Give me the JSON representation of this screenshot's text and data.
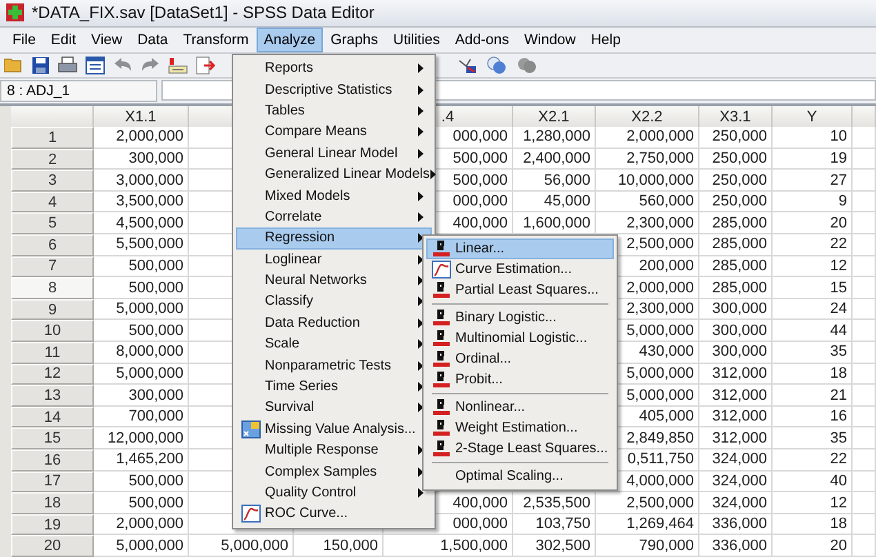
{
  "window": {
    "title": "*DATA_FIX.sav [DataSet1] - SPSS Data Editor"
  },
  "menu_bar": [
    {
      "label": "File",
      "selected": false
    },
    {
      "label": "Edit",
      "selected": false
    },
    {
      "label": "View",
      "selected": false
    },
    {
      "label": "Data",
      "selected": false
    },
    {
      "label": "Transform",
      "selected": false
    },
    {
      "label": "Analyze",
      "selected": true
    },
    {
      "label": "Graphs",
      "selected": false
    },
    {
      "label": "Utilities",
      "selected": false
    },
    {
      "label": "Add-ons",
      "selected": false
    },
    {
      "label": "Window",
      "selected": false
    },
    {
      "label": "Help",
      "selected": false
    }
  ],
  "cell_editor": {
    "reference": "8 : ADJ_1"
  },
  "table": {
    "columns": [
      "X1.1",
      null,
      null,
      ".4",
      "X2.1",
      "X2.2",
      "X3.1",
      "Y"
    ],
    "rows": [
      {
        "number": "1",
        "selected": false,
        "cells": [
          "2,000,000",
          null,
          null,
          "000,000",
          "1,280,000",
          "2,000,000",
          "250,000",
          "10"
        ]
      },
      {
        "number": "2",
        "selected": false,
        "cells": [
          "300,000",
          null,
          null,
          "500,000",
          "2,400,000",
          "2,750,000",
          "250,000",
          "19"
        ]
      },
      {
        "number": "3",
        "selected": false,
        "cells": [
          "3,000,000",
          null,
          null,
          "500,000",
          "56,000",
          "10,000,000",
          "250,000",
          "27"
        ]
      },
      {
        "number": "4",
        "selected": false,
        "cells": [
          "3,500,000",
          null,
          null,
          "000,000",
          "45,000",
          "560,000",
          "250,000",
          "9"
        ]
      },
      {
        "number": "5",
        "selected": false,
        "cells": [
          "4,500,000",
          null,
          null,
          "400,000",
          "1,600,000",
          "2,300,000",
          "285,000",
          "20"
        ]
      },
      {
        "number": "6",
        "selected": false,
        "cells": [
          "5,500,000",
          null,
          null,
          null,
          null,
          "2,500,000",
          "285,000",
          "22"
        ]
      },
      {
        "number": "7",
        "selected": false,
        "cells": [
          "500,000",
          null,
          null,
          null,
          null,
          "200,000",
          "285,000",
          "12"
        ]
      },
      {
        "number": "8",
        "selected": true,
        "cells": [
          "500,000",
          null,
          null,
          null,
          null,
          "2,000,000",
          "285,000",
          "15"
        ]
      },
      {
        "number": "9",
        "selected": false,
        "cells": [
          "5,000,000",
          null,
          null,
          null,
          null,
          "2,300,000",
          "300,000",
          "24"
        ]
      },
      {
        "number": "10",
        "selected": false,
        "cells": [
          "500,000",
          null,
          null,
          null,
          null,
          "5,000,000",
          "300,000",
          "44"
        ]
      },
      {
        "number": "11",
        "selected": false,
        "cells": [
          "8,000,000",
          null,
          null,
          null,
          null,
          "430,000",
          "300,000",
          "35"
        ]
      },
      {
        "number": "12",
        "selected": false,
        "cells": [
          "5,000,000",
          null,
          null,
          null,
          null,
          "5,000,000",
          "312,000",
          "18"
        ]
      },
      {
        "number": "13",
        "selected": false,
        "cells": [
          "300,000",
          null,
          null,
          null,
          null,
          "5,000,000",
          "312,000",
          "21"
        ]
      },
      {
        "number": "14",
        "selected": false,
        "cells": [
          "700,000",
          null,
          null,
          null,
          null,
          "405,000",
          "312,000",
          "16"
        ]
      },
      {
        "number": "15",
        "selected": false,
        "cells": [
          "12,000,000",
          null,
          null,
          null,
          null,
          "2,849,850",
          "312,000",
          "35"
        ]
      },
      {
        "number": "16",
        "selected": false,
        "cells": [
          "1,465,200",
          null,
          null,
          null,
          null,
          "0,511,750",
          "324,000",
          "22"
        ]
      },
      {
        "number": "17",
        "selected": false,
        "cells": [
          "500,000",
          null,
          null,
          null,
          null,
          "4,000,000",
          "324,000",
          "40"
        ]
      },
      {
        "number": "18",
        "selected": false,
        "cells": [
          "500,000",
          null,
          null,
          "400,000",
          "2,535,500",
          "2,500,000",
          "324,000",
          "12"
        ]
      },
      {
        "number": "19",
        "selected": false,
        "cells": [
          "2,000,000",
          null,
          null,
          "000,000",
          "103,750",
          "1,269,464",
          "336,000",
          "18"
        ]
      },
      {
        "number": "20",
        "selected": false,
        "cells": [
          "5,000,000",
          "5,000,000",
          "150,000",
          "1,500,000",
          "302,500",
          "790,000",
          "336,000",
          "20"
        ]
      }
    ]
  },
  "analyze_menu": {
    "items": [
      {
        "label": "Reports",
        "kind": "submenu",
        "selected": false
      },
      {
        "label": "Descriptive Statistics",
        "kind": "submenu",
        "selected": false
      },
      {
        "label": "Tables",
        "kind": "submenu",
        "selected": false
      },
      {
        "label": "Compare Means",
        "kind": "submenu",
        "selected": false
      },
      {
        "label": "General Linear Model",
        "kind": "submenu",
        "selected": false
      },
      {
        "label": "Generalized Linear Models",
        "kind": "submenu",
        "selected": false
      },
      {
        "label": "Mixed Models",
        "kind": "submenu",
        "selected": false
      },
      {
        "label": "Correlate",
        "kind": "submenu",
        "selected": false
      },
      {
        "label": "Regression",
        "kind": "submenu",
        "selected": true
      },
      {
        "label": "Loglinear",
        "kind": "submenu",
        "selected": false
      },
      {
        "label": "Neural Networks",
        "kind": "submenu",
        "selected": false
      },
      {
        "label": "Classify",
        "kind": "submenu",
        "selected": false
      },
      {
        "label": "Data Reduction",
        "kind": "submenu",
        "selected": false
      },
      {
        "label": "Scale",
        "kind": "submenu",
        "selected": false
      },
      {
        "label": "Nonparametric Tests",
        "kind": "submenu",
        "selected": false
      },
      {
        "label": "Time Series",
        "kind": "submenu",
        "selected": false
      },
      {
        "label": "Survival",
        "kind": "submenu",
        "selected": false
      },
      {
        "label": "Missing Value Analysis...",
        "kind": "grid",
        "selected": false
      },
      {
        "label": "Multiple Response",
        "kind": "submenu",
        "selected": false
      },
      {
        "label": "Complex Samples",
        "kind": "submenu",
        "selected": false
      },
      {
        "label": "Quality Control",
        "kind": "submenu",
        "selected": false
      },
      {
        "label": "ROC Curve...",
        "kind": "curve",
        "selected": false
      }
    ]
  },
  "regression_menu": {
    "items": [
      {
        "label": "Linear...",
        "kind": "regression",
        "selected": true
      },
      {
        "label": "Curve Estimation...",
        "kind": "curve",
        "selected": false
      },
      {
        "label": "Partial Least Squares...",
        "kind": "regression",
        "selected": false
      },
      {
        "kind": "separator"
      },
      {
        "label": "Binary Logistic...",
        "kind": "regression",
        "selected": false
      },
      {
        "label": "Multinomial Logistic...",
        "kind": "regression",
        "selected": false
      },
      {
        "label": "Ordinal...",
        "kind": "regression",
        "selected": false
      },
      {
        "label": "Probit...",
        "kind": "regression",
        "selected": false
      },
      {
        "kind": "separator"
      },
      {
        "label": "Nonlinear...",
        "kind": "regression",
        "selected": false
      },
      {
        "label": "Weight Estimation...",
        "kind": "regression",
        "selected": false
      },
      {
        "label": "2-Stage Least Squares...",
        "kind": "regression",
        "selected": false
      },
      {
        "kind": "separator"
      },
      {
        "label": "Optimal Scaling...",
        "kind": "plain",
        "selected": false
      }
    ]
  }
}
